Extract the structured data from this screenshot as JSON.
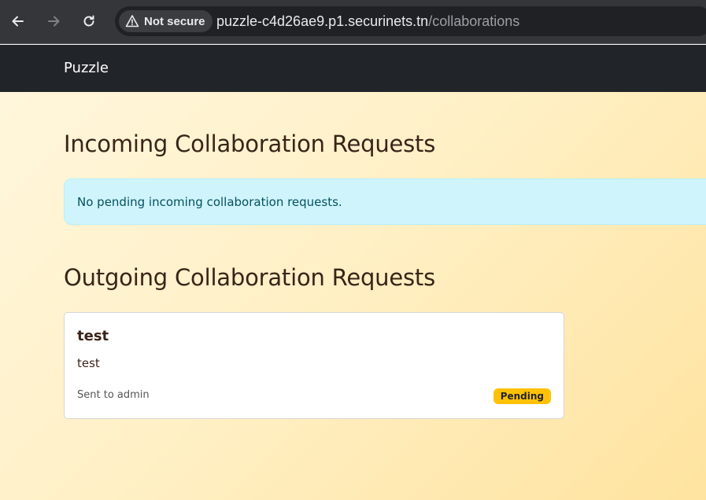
{
  "browser": {
    "security_label": "Not secure",
    "url_host": "puzzle-c4d26ae9.p1.securinets.tn",
    "url_path": "/collaborations",
    "icons": {
      "back": "arrow-left-icon",
      "forward": "arrow-right-icon",
      "reload": "reload-icon",
      "security": "warning-triangle-icon"
    }
  },
  "navbar": {
    "brand": "Puzzle",
    "background": "#212529"
  },
  "incoming": {
    "title": "Incoming Collaboration Requests",
    "empty_message": "No pending incoming collaboration requests."
  },
  "outgoing": {
    "title": "Outgoing Collaboration Requests",
    "requests": [
      {
        "title": "test",
        "description": "test",
        "meta": "Sent to admin",
        "status": "Pending",
        "status_color": "#ffc107"
      }
    ]
  },
  "colors": {
    "alert_bg": "#cff4fc",
    "alert_text": "#055160",
    "heading_text": "#3a2418",
    "page_gradient_start": "#fff6dc",
    "page_gradient_end": "#ffe39f"
  }
}
